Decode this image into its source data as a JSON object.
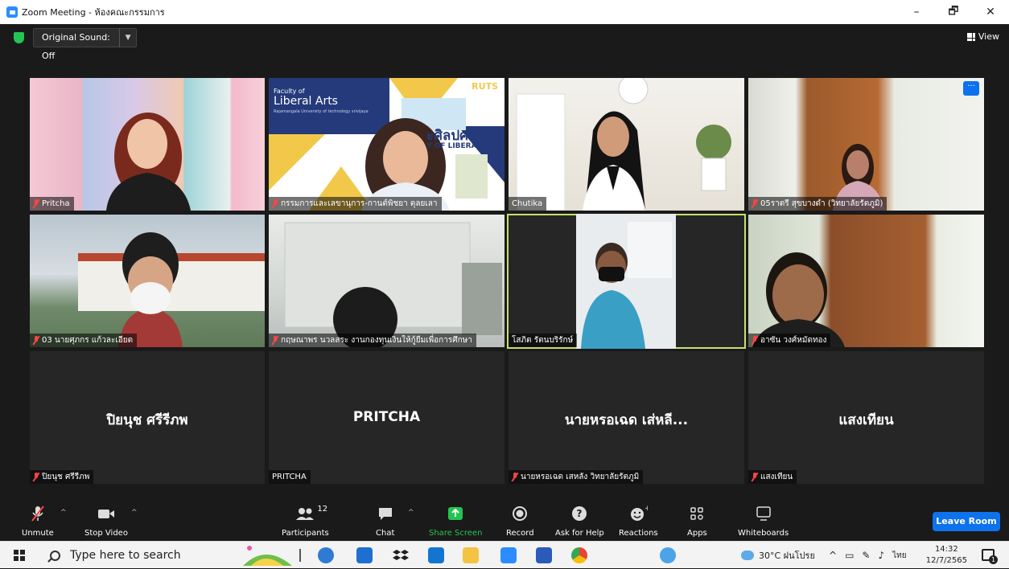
{
  "window": {
    "title": "Zoom Meeting - ห้องคณะกรรมการ",
    "min": "–",
    "max": "🗗",
    "close": "✕"
  },
  "topbar": {
    "original_sound": "Original Sound: Off",
    "view": "View"
  },
  "tiles_row1": [
    {
      "name": "Pritcha"
    },
    {
      "name": "กรรมการและเลขานุการ-กานต์พิชยา ตุลยเลา",
      "slide_line1": "Faculty of",
      "slide_line2": "Liberal Arts",
      "slide_line3": "Rajamangala University of technology srivijaya",
      "slide_brand": "RUTS",
      "slide_thai": "ะศิลปศาสตร์",
      "slide_en": "Y OF LIBERAL ART"
    },
    {
      "name": "Chutika"
    },
    {
      "name": "05ราตรี สุขบางดำ (วิทยาลัยรัตภูมิ)",
      "more": "···"
    }
  ],
  "tiles_row2": [
    {
      "name": "03 นายศุภกร แก้วละเอียด"
    },
    {
      "name": "กฤษณาพร นวลสระ งานกองทุนเงินให้กู้ยืมเพื่อการศึกษา"
    },
    {
      "name": "โสภิต รัตนบริรักษ์"
    },
    {
      "name": "อาซัน วงศ์หมัดทอง"
    }
  ],
  "tiles_row3": [
    {
      "big": "ปิยนุช ศรีรีภพ",
      "name": "ปิยนุช ศรีรีภพ"
    },
    {
      "big": "PRITCHA",
      "name": "PRITCHA"
    },
    {
      "big": "นายหรอเฉด เส่หลี...",
      "name": "นายหรอเฉด เสหลัง วิทยาลัยรัตภูมิ"
    },
    {
      "big": "แสงเทียน",
      "name": "แสงเทียน"
    }
  ],
  "toolbar": {
    "unmute": "Unmute",
    "stop_video": "Stop Video",
    "participants": "Participants",
    "participants_count": "12",
    "chat": "Chat",
    "share_screen": "Share Screen",
    "record": "Record",
    "ask_for_help": "Ask for Help",
    "reactions": "Reactions",
    "apps": "Apps",
    "whiteboards": "Whiteboards",
    "leave": "Leave Room"
  },
  "taskbar": {
    "search_placeholder": "Type here to search",
    "weather": "30°C ฝนโปรย",
    "lang": "ไทย",
    "time": "14:32",
    "date": "12/7/2565",
    "notif_count": "1"
  },
  "colors": {
    "accent": "#0e72ed",
    "share": "#23c552",
    "active_speaker": "#c8e06a",
    "muted": "#ff4444"
  }
}
